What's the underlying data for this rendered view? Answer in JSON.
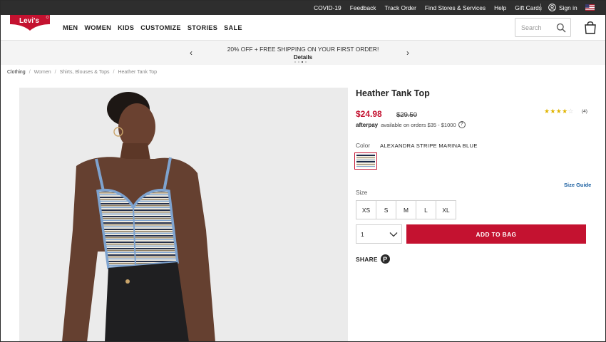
{
  "utility": {
    "links": [
      "COVID-19",
      "Feedback",
      "Track Order",
      "Find Stores & Services",
      "Help",
      "Gift Cards"
    ],
    "sign_in": "Sign in"
  },
  "header": {
    "logo_text": "Levi's",
    "nav": [
      "MEN",
      "WOMEN",
      "KIDS",
      "CUSTOMIZE",
      "STORIES",
      "SALE"
    ],
    "search_placeholder": "Search"
  },
  "promo": {
    "message": "20% OFF + FREE SHIPPING ON YOUR FIRST ORDER!",
    "details": "Details",
    "prev": "‹",
    "next": "›",
    "slides": 4,
    "active_slide": 3
  },
  "breadcrumb": [
    "Clothing",
    "Women",
    "Shirts, Blouses & Tops",
    "Heather Tank Top"
  ],
  "product": {
    "title": "Heather Tank Top",
    "price": "$24.98",
    "original_price": "$29.50",
    "rating": 4,
    "rating_max": 5,
    "review_count": "(4)",
    "afterpay_brand": "afterpay",
    "afterpay_text": "available on orders $35 - $1000",
    "afterpay_info": "?",
    "color_label": "Color",
    "color_value": "ALEXANDRA STRIPE MARINA BLUE",
    "size_label": "Size",
    "size_guide": "Size Guide",
    "sizes": [
      "XS",
      "S",
      "M",
      "L",
      "XL"
    ],
    "quantity": "1",
    "add_to_bag": "ADD TO BAG",
    "share_label": "SHARE",
    "pinterest": "P"
  },
  "colors": {
    "accent": "#c41230",
    "utility_bar": "#2e2e2e",
    "link": "#1a5fa0",
    "star": "#e0b400"
  }
}
